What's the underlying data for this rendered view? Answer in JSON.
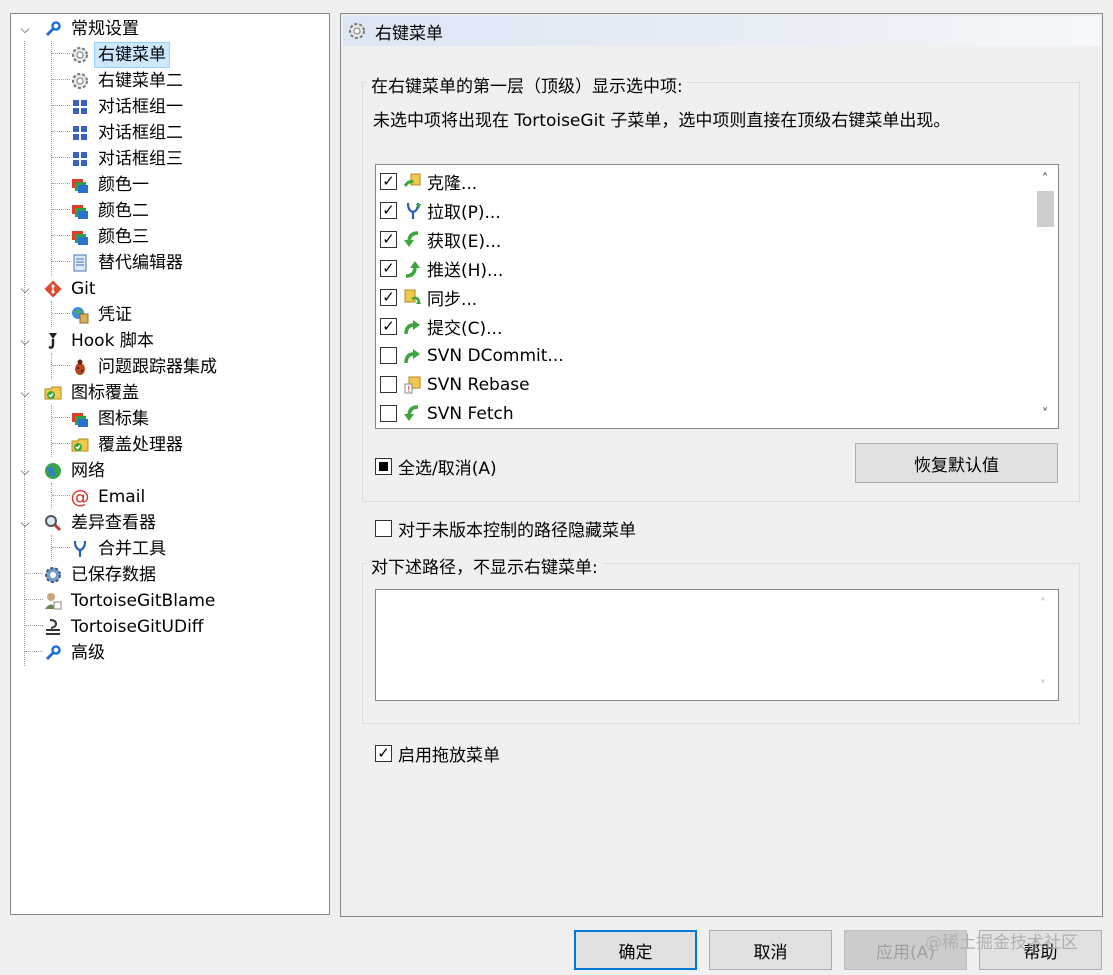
{
  "tree": {
    "items": [
      {
        "label": "常规设置",
        "icon": "wrench-icon",
        "expander": "expanded"
      },
      {
        "label": "右键菜单",
        "icon": "gear-icon",
        "selected": true
      },
      {
        "label": "右键菜单二",
        "icon": "gear-icon"
      },
      {
        "label": "对话框组一",
        "icon": "windows-flag-icon"
      },
      {
        "label": "对话框组二",
        "icon": "windows-flag-icon"
      },
      {
        "label": "对话框组三",
        "icon": "windows-flag-icon"
      },
      {
        "label": "颜色一",
        "icon": "color-window-icon"
      },
      {
        "label": "颜色二",
        "icon": "color-window-icon"
      },
      {
        "label": "颜色三",
        "icon": "color-window-icon"
      },
      {
        "label": "替代编辑器",
        "icon": "notepad-icon"
      },
      {
        "label": "Git",
        "icon": "git-icon",
        "expander": "expanded"
      },
      {
        "label": "凭证",
        "icon": "credential-icon"
      },
      {
        "label": "Hook 脚本",
        "icon": "hook-icon",
        "expander": "expanded"
      },
      {
        "label": "问题跟踪器集成",
        "icon": "bug-icon"
      },
      {
        "label": "图标覆盖",
        "icon": "overlay-folder-icon",
        "expander": "expanded"
      },
      {
        "label": "图标集",
        "icon": "color-window-icon"
      },
      {
        "label": "覆盖处理器",
        "icon": "overlay-folder-icon"
      },
      {
        "label": "网络",
        "icon": "globe-icon",
        "expander": "expanded"
      },
      {
        "label": "Email",
        "icon": "at-icon"
      },
      {
        "label": "差异查看器",
        "icon": "magnifier-icon",
        "expander": "expanded"
      },
      {
        "label": "合并工具",
        "icon": "merge-icon"
      },
      {
        "label": "已保存数据",
        "icon": "saved-data-icon"
      },
      {
        "label": "TortoiseGitBlame",
        "icon": "blame-icon"
      },
      {
        "label": "TortoiseGitUDiff",
        "icon": "udiff-icon"
      },
      {
        "label": "高级",
        "icon": "wrench-icon"
      }
    ]
  },
  "panel": {
    "title": "右键菜单",
    "title_icon": "gear-icon",
    "group1_label": "在右键菜单的第一层（顶级）显示选中项:",
    "group1_desc": "未选中项将出现在 TortoiseGit 子菜单，选中项则直接在顶级右键菜单出现。",
    "menu_items": [
      {
        "label": "克隆...",
        "checked": true,
        "icon": "clone-icon"
      },
      {
        "label": "拉取(P)...",
        "checked": true,
        "icon": "pull-icon"
      },
      {
        "label": "获取(E)...",
        "checked": true,
        "icon": "fetch-icon"
      },
      {
        "label": "推送(H)...",
        "checked": true,
        "icon": "push-icon"
      },
      {
        "label": "同步...",
        "checked": true,
        "icon": "sync-icon"
      },
      {
        "label": "提交(C)...",
        "checked": true,
        "icon": "commit-icon"
      },
      {
        "label": "SVN DCommit...",
        "checked": false,
        "icon": "commit-icon"
      },
      {
        "label": "SVN Rebase",
        "checked": false,
        "icon": "rebase-icon"
      },
      {
        "label": "SVN Fetch",
        "checked": false,
        "icon": "fetch-icon"
      }
    ],
    "select_all_label": "全选/取消(A)",
    "restore_defaults_label": "恢复默认值",
    "hide_unversioned_label": "对于未版本控制的路径隐藏菜单",
    "hide_unversioned_checked": false,
    "exclude_paths_label": "对下述路径，不显示右键菜单:",
    "exclude_paths_value": "",
    "enable_drag_label": "启用拖放菜单",
    "enable_drag_checked": true
  },
  "buttons": {
    "ok": "确定",
    "cancel": "取消",
    "apply": "应用(A)",
    "help": "帮助"
  },
  "watermark": "@稀土掘金技术社区",
  "colors": {
    "selection": "#cce8ff",
    "default_button_border": "#0078d7",
    "header_gradient_start": "#dce6f4"
  }
}
